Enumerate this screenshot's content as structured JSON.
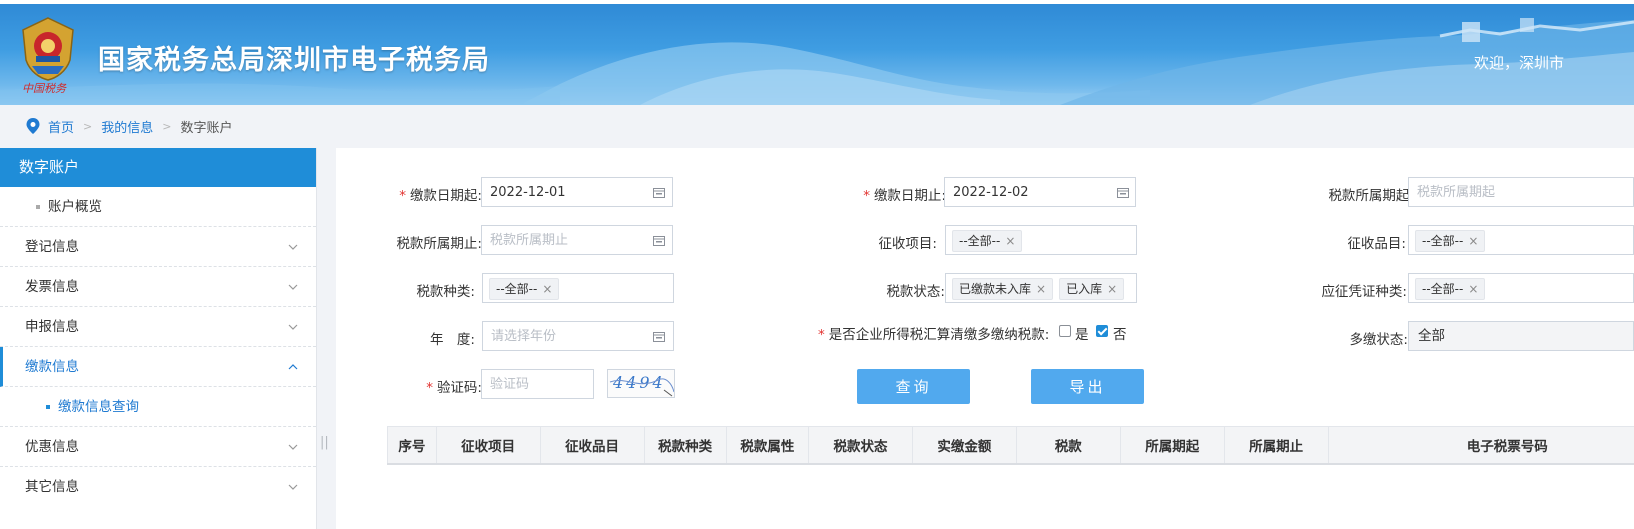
{
  "header": {
    "site_title": "国家税务总局深圳市电子税务局",
    "emblem_caption": "中国税务",
    "welcome": "欢迎，深圳市"
  },
  "breadcrumb": {
    "home": "首页",
    "my_info": "我的信息",
    "current": "数字账户",
    "separator": ">"
  },
  "sidebar": {
    "title": "数字账户",
    "items": [
      {
        "label": "账户概览",
        "type": "sub"
      },
      {
        "label": "登记信息",
        "type": "group"
      },
      {
        "label": "发票信息",
        "type": "group"
      },
      {
        "label": "申报信息",
        "type": "group"
      },
      {
        "label": "缴款信息",
        "type": "group",
        "expanded": true
      },
      {
        "label": "缴款信息查询",
        "type": "sub",
        "selected": true
      },
      {
        "label": "优惠信息",
        "type": "group"
      },
      {
        "label": "其它信息",
        "type": "group"
      }
    ],
    "splitter_glyph": "||"
  },
  "form": {
    "required_mark": "*",
    "payment_date_start": {
      "label": "缴款日期起:",
      "value": "2022-12-01"
    },
    "payment_date_end": {
      "label": "缴款日期止:",
      "value": "2022-12-02"
    },
    "tax_period_start": {
      "label": "税款所属期起:",
      "placeholder": "税款所属期起"
    },
    "tax_period_end": {
      "label": "税款所属期止:",
      "placeholder": "税款所属期止"
    },
    "levy_item": {
      "label": "征收项目:",
      "tags": [
        "--全部--"
      ]
    },
    "levy_subitem": {
      "label": "征收品目:",
      "tags": [
        "--全部--"
      ]
    },
    "tax_type": {
      "label": "税款种类:",
      "tags": [
        "--全部--"
      ]
    },
    "tax_status": {
      "label": "税款状态:",
      "tags": [
        "已缴款未入库",
        "已入库"
      ]
    },
    "voucher_type": {
      "label": "应征凭证种类:",
      "tags": [
        "--全部--"
      ]
    },
    "year": {
      "label": "年　度:",
      "placeholder": "请选择年份"
    },
    "overpaid_question": {
      "label": "是否企业所得税汇算清缴多缴纳税款:",
      "yes": "是",
      "no": "否",
      "yes_checked": false,
      "no_checked": true
    },
    "overpaid_status": {
      "label": "多缴状态:",
      "value": "全部"
    },
    "captcha": {
      "label": "验证码:",
      "placeholder": "验证码",
      "image_text": "4494"
    },
    "tag_remove": "×"
  },
  "buttons": {
    "query": "查询",
    "export": "导出"
  },
  "table": {
    "columns": [
      "序号",
      "征收项目",
      "征收品目",
      "税款种类",
      "税款属性",
      "税款状态",
      "实缴金额",
      "税款",
      "所属期起",
      "所属期止",
      "电子税票号码"
    ]
  },
  "colors": {
    "primary": "#1f8dd8",
    "button": "#51a9ee",
    "required": "#e2322f",
    "link": "#1f7ad1"
  }
}
